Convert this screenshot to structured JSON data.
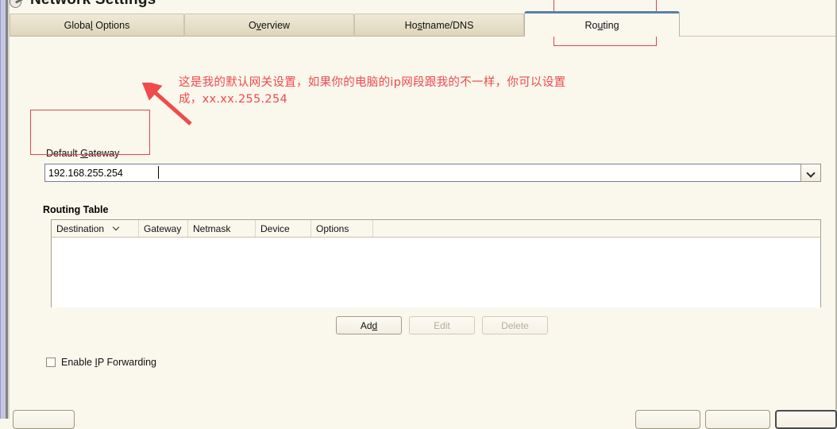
{
  "window": {
    "title": "Network Settings",
    "title_icon": "network-wrench-icon"
  },
  "tabs": [
    {
      "id": "global-options",
      "label": "Global Options",
      "mnemonic": "l",
      "active": false
    },
    {
      "id": "overview",
      "label": "Overview",
      "mnemonic": "v",
      "active": false
    },
    {
      "id": "hostname-dns",
      "label": "Hostname/DNS",
      "mnemonic": "s",
      "active": false
    },
    {
      "id": "routing",
      "label": "Routing",
      "mnemonic": "u",
      "active": true
    }
  ],
  "gateway": {
    "label_before": "Default ",
    "label_mnemonic": "G",
    "label_after": "ateway",
    "value": "192.168.255.254",
    "placeholder": "",
    "dropdown_icon": "chevron-down-icon"
  },
  "routing_table": {
    "title": "Routing Table",
    "columns": [
      "Destination",
      "Gateway",
      "Netmask",
      "Device",
      "Options"
    ],
    "sorted_column": "Destination",
    "sort_icon": "chevron-down-icon",
    "rows": []
  },
  "table_buttons": [
    {
      "id": "add",
      "label_before": "Ad",
      "mnemonic": "d",
      "label_after": "",
      "enabled": true
    },
    {
      "id": "edit",
      "label_before": "Edit",
      "mnemonic": "",
      "label_after": "",
      "enabled": false
    },
    {
      "id": "delete",
      "label_before": "Delete",
      "mnemonic": "",
      "label_after": "",
      "enabled": false
    }
  ],
  "ip_forwarding": {
    "label_before": "Enable ",
    "mnemonic": "I",
    "label_after": "P Forwarding",
    "checked": false
  },
  "bottom_buttons": [
    {
      "id": "help",
      "label": ""
    },
    {
      "id": "back",
      "label": ""
    },
    {
      "id": "abort",
      "label": ""
    },
    {
      "id": "next",
      "label": ""
    }
  ],
  "annotations": {
    "color": "#ef4b4b",
    "text_line1": "这是我的默认网关设置，如果你的电脑的ip网段跟我的不一样，你可以设置",
    "text_line2": "成，xx.xx.255.254",
    "boxes": [
      "routing-tab-highlight",
      "default-gateway-highlight"
    ],
    "arrow": "red-arrow-pointing-to-annotation"
  }
}
